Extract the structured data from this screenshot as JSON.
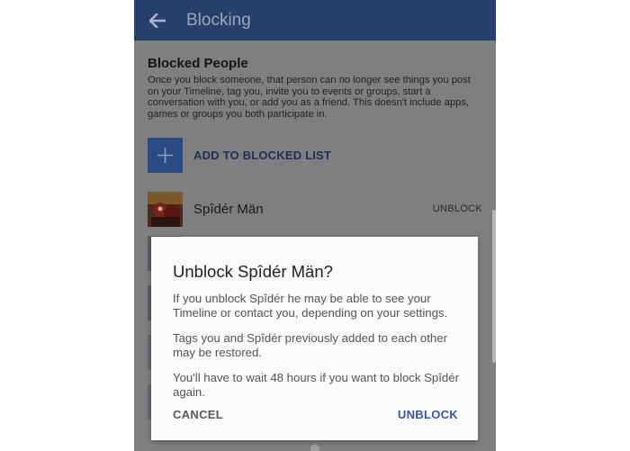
{
  "appbar": {
    "title": "Blocking",
    "back_icon": "arrow-left-icon"
  },
  "section": {
    "title": "Blocked People",
    "description": "Once you block someone, that person can no longer see things you post on your Timeline, tag you, invite you to events or groups, start a conversation with you, or add you as a friend. This doesn't include apps, games or groups you both participate in."
  },
  "add_to_blocked": {
    "icon": "plus-icon",
    "label": "ADD TO BLOCKED LIST"
  },
  "blocked_list": [
    {
      "name": "Spîdér Män",
      "action": "UNBLOCK"
    }
  ],
  "dialog": {
    "title": "Unblock Spîdér Män?",
    "paragraphs": [
      "If you unblock Spîdér he may be able to see your Timeline or contact you, depending on your settings.",
      "Tags you and Spîdér previously added to each other may be restored.",
      "You'll have to wait 48 hours if you want to block Spîdér again."
    ],
    "cancel_label": "CANCEL",
    "unblock_label": "UNBLOCK"
  },
  "colors": {
    "appbar": "#283f6c",
    "accent": "#3b5998",
    "overlay_background": "#7f7f82",
    "dialog_background": "#fafafa"
  }
}
